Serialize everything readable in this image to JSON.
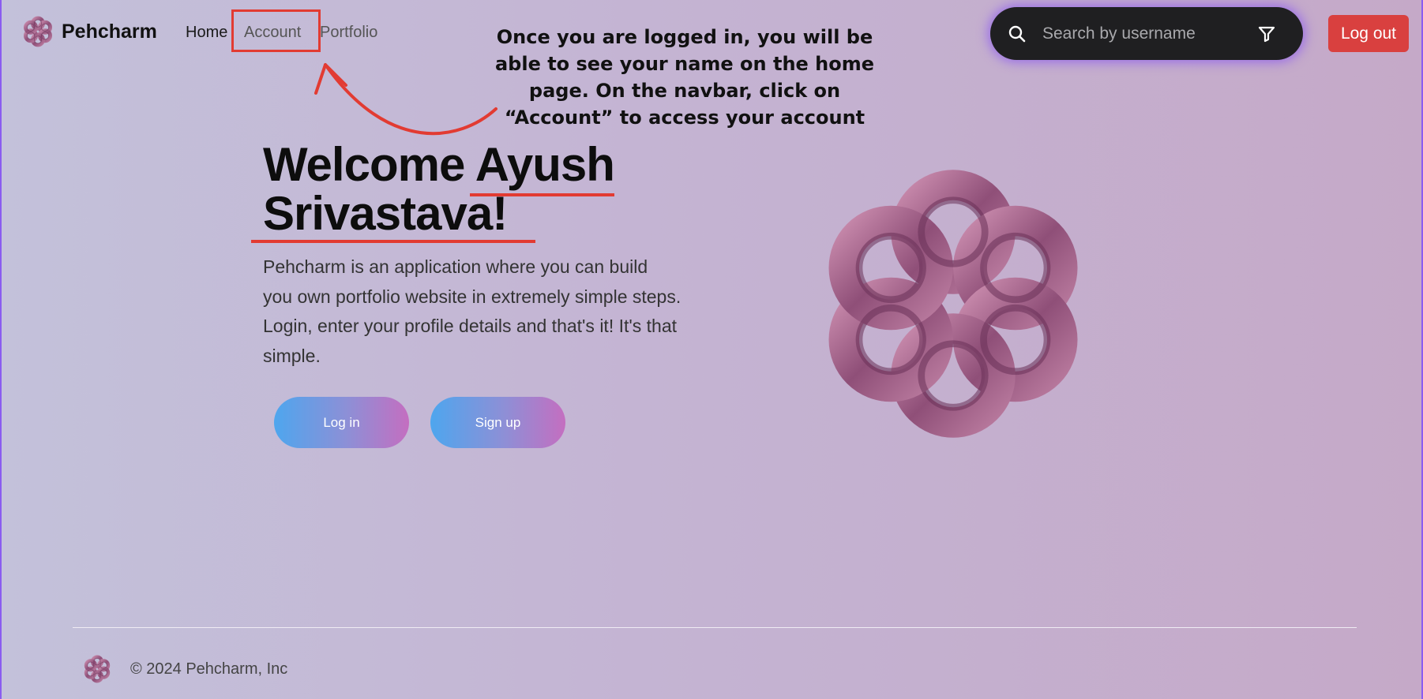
{
  "brand": {
    "name": "Pehcharm",
    "logo_icon": "flower-logo-icon"
  },
  "nav": {
    "home": "Home",
    "account": "Account",
    "portfolio": "Portfolio"
  },
  "instruction": "Once you are logged in, you will be able to see your name on the home page. On the navbar, click on “Account” to access your account",
  "search": {
    "placeholder": "Search by username",
    "icon": "search-icon",
    "filter_icon": "filter-icon"
  },
  "logout_label": "Log out",
  "hero": {
    "welcome_line1": "Welcome Ayush",
    "welcome_line2": "Srivastava!",
    "description": "Pehcharm is an application where you can build you own portfolio website in extremely simple steps. Login, enter your profile details and that's it! It's that simple.",
    "login_label": "Log in",
    "signup_label": "Sign up"
  },
  "footer": {
    "copyright": "© 2024 Pehcharm, Inc"
  },
  "colors": {
    "accent_red": "#e23b32",
    "logout_bg": "#d9403f",
    "search_bg": "#1f1f21",
    "logo_mauve": "#9c5f86"
  }
}
